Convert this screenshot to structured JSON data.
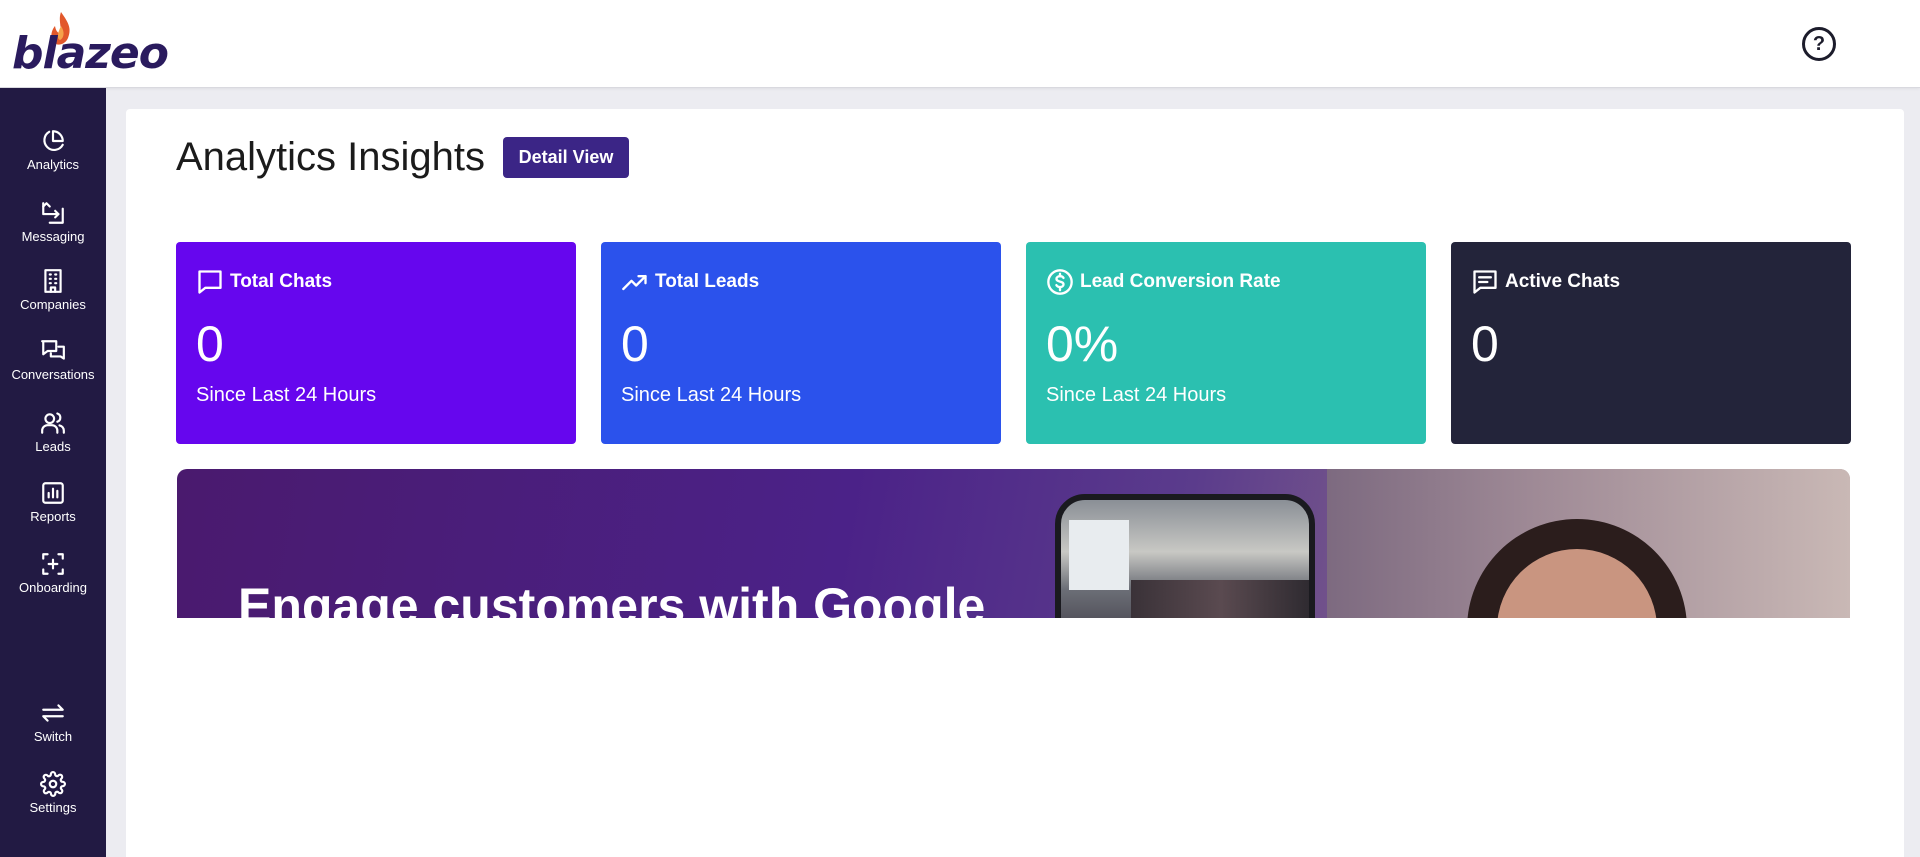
{
  "header": {
    "logo_text": "blazeo",
    "help_label": "?"
  },
  "sidebar": {
    "items": [
      {
        "label": "Analytics",
        "icon": "pie-chart-icon"
      },
      {
        "label": "Messaging",
        "icon": "message-forward-icon"
      },
      {
        "label": "Companies",
        "icon": "building-icon"
      },
      {
        "label": "Conversations",
        "icon": "chat-bubbles-icon"
      },
      {
        "label": "Leads",
        "icon": "users-icon"
      },
      {
        "label": "Reports",
        "icon": "bar-report-icon"
      },
      {
        "label": "Onboarding",
        "icon": "add-frame-icon"
      },
      {
        "label": "Switch",
        "icon": "swap-arrows-icon"
      },
      {
        "label": "Settings",
        "icon": "gear-icon"
      }
    ]
  },
  "main": {
    "title": "Analytics Insights",
    "detail_button": "Detail View",
    "cards": [
      {
        "title": "Total Chats",
        "value": "0",
        "subtitle": "Since Last 24 Hours",
        "color": "#6606ee",
        "icon": "chat-square-icon"
      },
      {
        "title": "Total Leads",
        "value": "0",
        "subtitle": "Since Last 24 Hours",
        "color": "#2b52ec",
        "icon": "trending-up-icon"
      },
      {
        "title": "Lead Conversion Rate",
        "value": "0%",
        "subtitle": "Since Last 24 Hours",
        "color": "#2bc0b0",
        "icon": "dollar-circle-icon"
      },
      {
        "title": "Active Chats",
        "value": "0",
        "subtitle": "",
        "color": "#23243a",
        "icon": "message-lines-icon"
      }
    ],
    "banner": {
      "headline": "Engage customers with Google"
    }
  }
}
